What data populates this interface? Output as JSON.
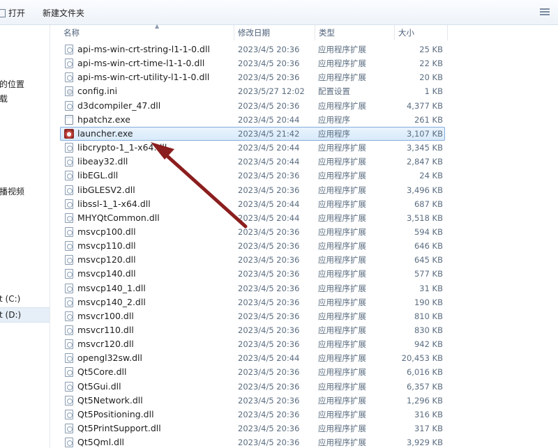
{
  "toolbar": {
    "open_label": "打开",
    "new_folder_label": "新建文件夹"
  },
  "nav": {
    "items": [
      {
        "label": "的位置"
      },
      {
        "label": "载"
      },
      {
        "label": "播视频"
      },
      {
        "label": "t (C:)"
      },
      {
        "label": "t (D:)"
      }
    ]
  },
  "columns": {
    "name": "名称",
    "date": "修改日期",
    "type": "类型",
    "size": "大小"
  },
  "files": [
    {
      "name": "api-ms-win-crt-string-l1-1-0.dll",
      "date": "2023/4/5 20:36",
      "type": "应用程序扩展",
      "size": "25 KB",
      "icon": "dll-file-icon"
    },
    {
      "name": "api-ms-win-crt-time-l1-1-0.dll",
      "date": "2023/4/5 20:36",
      "type": "应用程序扩展",
      "size": "22 KB",
      "icon": "dll-file-icon"
    },
    {
      "name": "api-ms-win-crt-utility-l1-1-0.dll",
      "date": "2023/4/5 20:36",
      "type": "应用程序扩展",
      "size": "20 KB",
      "icon": "dll-file-icon"
    },
    {
      "name": "config.ini",
      "date": "2023/5/27 12:02",
      "type": "配置设置",
      "size": "1 KB",
      "icon": "ini-file-icon"
    },
    {
      "name": "d3dcompiler_47.dll",
      "date": "2023/4/5 20:36",
      "type": "应用程序扩展",
      "size": "4,377 KB",
      "icon": "dll-file-icon"
    },
    {
      "name": "hpatchz.exe",
      "date": "2023/4/5 20:44",
      "type": "应用程序",
      "size": "261 KB",
      "icon": "exe-file-icon"
    },
    {
      "name": "launcher.exe",
      "date": "2023/4/5 21:42",
      "type": "应用程序",
      "size": "3,107 KB",
      "icon": "launcher-app-icon"
    },
    {
      "name": "libcrypto-1_1-x64.dll",
      "date": "2023/4/5 20:44",
      "type": "应用程序扩展",
      "size": "3,345 KB",
      "icon": "dll-file-icon"
    },
    {
      "name": "libeay32.dll",
      "date": "2023/4/5 20:44",
      "type": "应用程序扩展",
      "size": "2,847 KB",
      "icon": "dll-file-icon"
    },
    {
      "name": "libEGL.dll",
      "date": "2023/4/5 20:36",
      "type": "应用程序扩展",
      "size": "24 KB",
      "icon": "dll-file-icon"
    },
    {
      "name": "libGLESV2.dll",
      "date": "2023/4/5 20:36",
      "type": "应用程序扩展",
      "size": "3,496 KB",
      "icon": "dll-file-icon"
    },
    {
      "name": "libssl-1_1-x64.dll",
      "date": "2023/4/5 20:44",
      "type": "应用程序扩展",
      "size": "687 KB",
      "icon": "dll-file-icon"
    },
    {
      "name": "MHYQtCommon.dll",
      "date": "2023/4/5 20:44",
      "type": "应用程序扩展",
      "size": "3,518 KB",
      "icon": "dll-file-icon"
    },
    {
      "name": "msvcp100.dll",
      "date": "2023/4/5 20:36",
      "type": "应用程序扩展",
      "size": "594 KB",
      "icon": "dll-file-icon"
    },
    {
      "name": "msvcp110.dll",
      "date": "2023/4/5 20:36",
      "type": "应用程序扩展",
      "size": "646 KB",
      "icon": "dll-file-icon"
    },
    {
      "name": "msvcp120.dll",
      "date": "2023/4/5 20:36",
      "type": "应用程序扩展",
      "size": "645 KB",
      "icon": "dll-file-icon"
    },
    {
      "name": "msvcp140.dll",
      "date": "2023/4/5 20:36",
      "type": "应用程序扩展",
      "size": "577 KB",
      "icon": "dll-file-icon"
    },
    {
      "name": "msvcp140_1.dll",
      "date": "2023/4/5 20:36",
      "type": "应用程序扩展",
      "size": "31 KB",
      "icon": "dll-file-icon"
    },
    {
      "name": "msvcp140_2.dll",
      "date": "2023/4/5 20:36",
      "type": "应用程序扩展",
      "size": "190 KB",
      "icon": "dll-file-icon"
    },
    {
      "name": "msvcr100.dll",
      "date": "2023/4/5 20:36",
      "type": "应用程序扩展",
      "size": "810 KB",
      "icon": "dll-file-icon"
    },
    {
      "name": "msvcr110.dll",
      "date": "2023/4/5 20:36",
      "type": "应用程序扩展",
      "size": "830 KB",
      "icon": "dll-file-icon"
    },
    {
      "name": "msvcr120.dll",
      "date": "2023/4/5 20:36",
      "type": "应用程序扩展",
      "size": "942 KB",
      "icon": "dll-file-icon"
    },
    {
      "name": "opengl32sw.dll",
      "date": "2023/4/5 20:44",
      "type": "应用程序扩展",
      "size": "20,453 KB",
      "icon": "dll-file-icon"
    },
    {
      "name": "Qt5Core.dll",
      "date": "2023/4/5 20:36",
      "type": "应用程序扩展",
      "size": "6,016 KB",
      "icon": "dll-file-icon"
    },
    {
      "name": "Qt5Gui.dll",
      "date": "2023/4/5 20:36",
      "type": "应用程序扩展",
      "size": "6,357 KB",
      "icon": "dll-file-icon"
    },
    {
      "name": "Qt5Network.dll",
      "date": "2023/4/5 20:36",
      "type": "应用程序扩展",
      "size": "1,296 KB",
      "icon": "dll-file-icon"
    },
    {
      "name": "Qt5Positioning.dll",
      "date": "2023/4/5 20:36",
      "type": "应用程序扩展",
      "size": "316 KB",
      "icon": "dll-file-icon"
    },
    {
      "name": "Qt5PrintSupport.dll",
      "date": "2023/4/5 20:36",
      "type": "应用程序扩展",
      "size": "317 KB",
      "icon": "dll-file-icon"
    },
    {
      "name": "Qt5Qml.dll",
      "date": "2023/4/5 20:36",
      "type": "应用程序扩展",
      "size": "3,929 KB",
      "icon": "dll-file-icon"
    }
  ],
  "selected_file_index": 6,
  "annotation": {
    "arrow_color": "#8b1e1e",
    "points_to": "launcher.exe"
  },
  "colors": {
    "selection_bg": "#d9ebfb",
    "selection_border": "#84acdd",
    "header_text": "#4c607a"
  }
}
